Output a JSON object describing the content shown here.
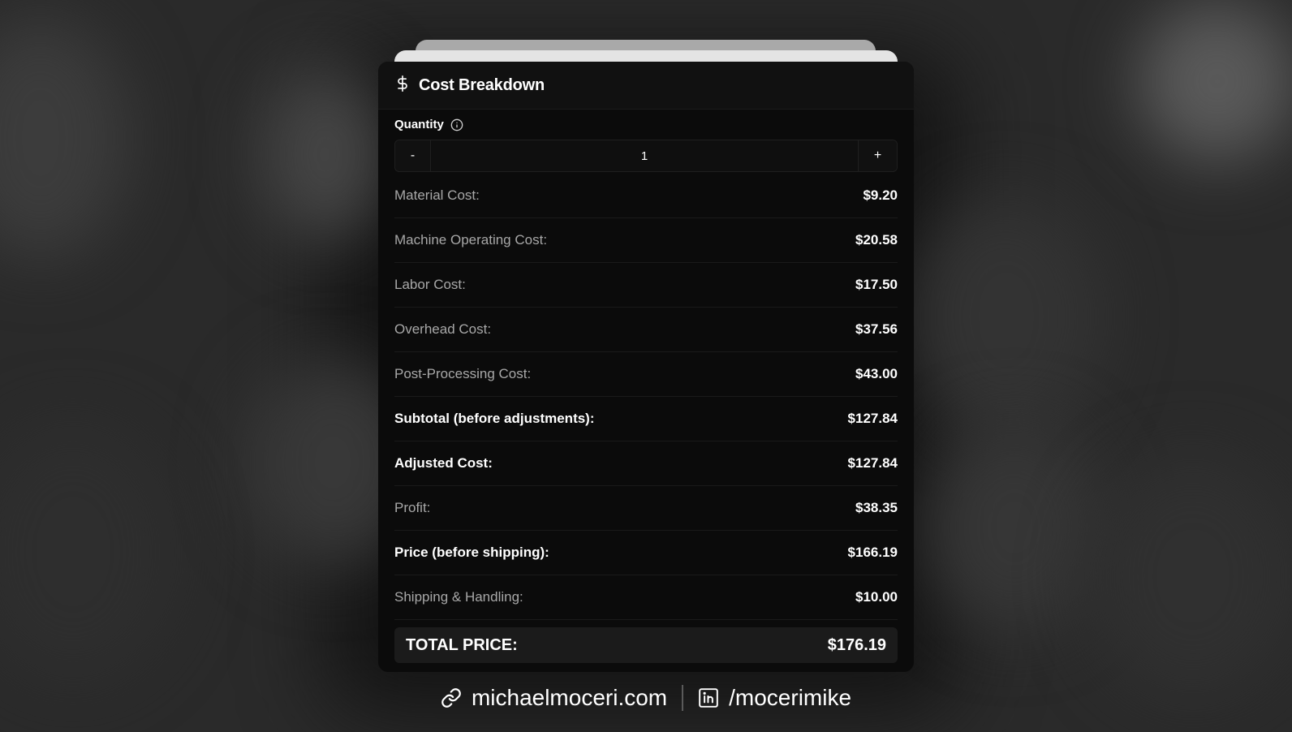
{
  "card": {
    "title": "Cost Breakdown",
    "title_icon": "dollar-sign-icon"
  },
  "quantity": {
    "label": "Quantity",
    "info_icon": "info-icon",
    "decrement_label": "-",
    "value": "1",
    "increment_label": "+"
  },
  "costs": [
    {
      "label": "Material Cost:",
      "value": "$9.20",
      "emphasis": false
    },
    {
      "label": "Machine Operating Cost:",
      "value": "$20.58",
      "emphasis": false
    },
    {
      "label": "Labor Cost:",
      "value": "$17.50",
      "emphasis": false
    },
    {
      "label": "Overhead Cost:",
      "value": "$37.56",
      "emphasis": false
    },
    {
      "label": "Post-Processing Cost:",
      "value": "$43.00",
      "emphasis": false
    },
    {
      "label": "Subtotal (before adjustments):",
      "value": "$127.84",
      "emphasis": true
    },
    {
      "label": "Adjusted Cost:",
      "value": "$127.84",
      "emphasis": true
    },
    {
      "label": "Profit:",
      "value": "$38.35",
      "emphasis": false
    },
    {
      "label": "Price (before shipping):",
      "value": "$166.19",
      "emphasis": true
    },
    {
      "label": "Shipping & Handling:",
      "value": "$10.00",
      "emphasis": false
    }
  ],
  "total": {
    "label": "TOTAL PRICE:",
    "value": "$176.19"
  },
  "footer": {
    "website": "michaelmoceri.com",
    "website_icon": "link-icon",
    "linkedin": "/mocerimike",
    "linkedin_icon": "linkedin-icon"
  },
  "colors": {
    "background": "#2a2a2a",
    "card": "#0b0b0b",
    "muted_text": "#a8a8a8",
    "text": "#ffffff"
  }
}
